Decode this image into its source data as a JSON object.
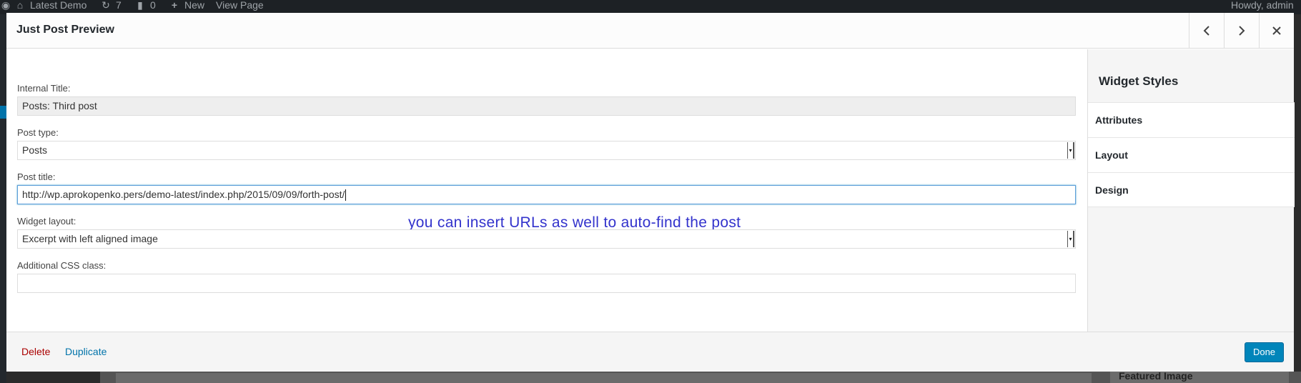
{
  "adminbar": {
    "site_name": "Latest Demo",
    "updates_count": "7",
    "comments_count": "0",
    "new_label": "New",
    "view_page_label": "View Page",
    "howdy": "Howdy, admin"
  },
  "modal": {
    "title": "Just Post Preview",
    "fields": {
      "internal_title": {
        "label": "Internal Title:",
        "value": "Posts: Third post"
      },
      "post_type": {
        "label": "Post type:",
        "value": "Posts"
      },
      "post_title": {
        "label": "Post title:",
        "value": "http://wp.aprokopenko.pers/demo-latest/index.php/2015/09/09/forth-post/"
      },
      "widget_layout": {
        "label": "Widget layout:",
        "value": "Excerpt with left aligned image"
      },
      "css_class": {
        "label": "Additional CSS class:",
        "value": ""
      }
    },
    "annotation": "you can insert URLs as well to auto-find the post",
    "sidebar": {
      "title": "Widget Styles",
      "sections": [
        "Attributes",
        "Layout",
        "Design"
      ]
    },
    "footer": {
      "delete_label": "Delete",
      "duplicate_label": "Duplicate",
      "done_label": "Done"
    }
  },
  "background": {
    "featured_image_label": "Featured Image"
  },
  "colors": {
    "accent": "#0085ba",
    "delete": "#aa0000",
    "link": "#0073aa",
    "annotation": "#3333cc"
  }
}
